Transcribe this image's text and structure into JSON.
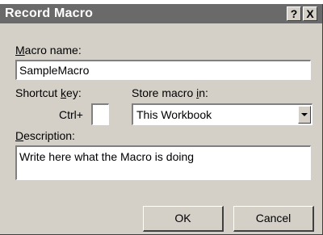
{
  "dialog": {
    "title": "Record Macro",
    "help_button": "?",
    "close_button": "X"
  },
  "macro_name": {
    "label_accel": "M",
    "label_rest": "acro name:",
    "value": "SampleMacro"
  },
  "shortcut": {
    "label_pre": "Shortcut ",
    "label_accel": "k",
    "label_post": "ey:",
    "prefix": "Ctrl+",
    "value": ""
  },
  "store_in": {
    "label_pre": "Store macro ",
    "label_accel": "i",
    "label_post": "n:",
    "selected": "This Workbook"
  },
  "description": {
    "label_accel": "D",
    "label_rest": "escription:",
    "value": "Write here what the Macro is doing"
  },
  "buttons": {
    "ok": "OK",
    "cancel": "Cancel"
  }
}
